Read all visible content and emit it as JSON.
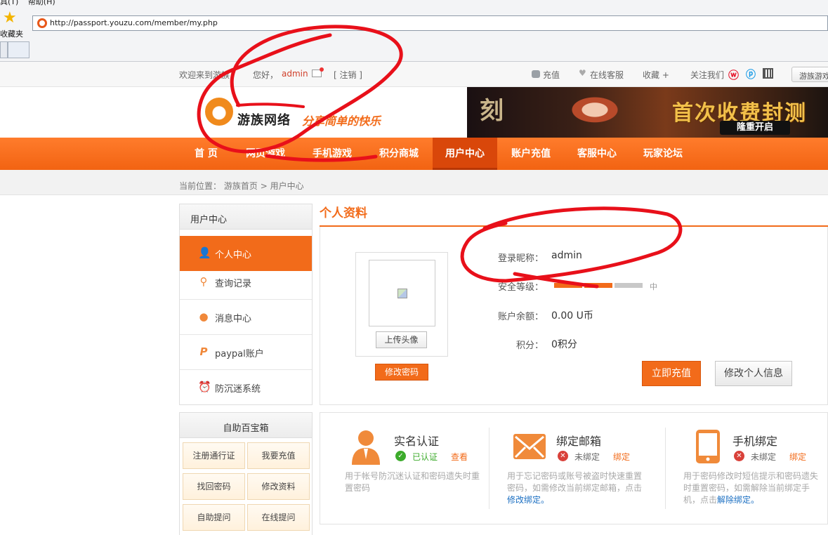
{
  "browser": {
    "menu_items": [
      "具(T)",
      "帮助(H)"
    ],
    "favorites_label": "收藏夹",
    "url": "http://passport.youzu.com/member/my.php"
  },
  "topbar": {
    "welcome": "欢迎来到游族！",
    "greeting": "您好，",
    "username": "admin",
    "logout": "[ 注销 ]",
    "recharge": "充值",
    "service": "在线客服",
    "favorite": "收藏 +",
    "follow": "关注我们",
    "site_switch": "游族游戏"
  },
  "header": {
    "logo_name": "游族网络",
    "slogan": "分享简单的快乐",
    "banner_deco": "刻",
    "banner_title": "首次收费封测",
    "banner_sub": "隆重开启"
  },
  "nav": {
    "items": [
      "首 页",
      "网页游戏",
      "手机游戏",
      "积分商城",
      "用户中心",
      "账户充值",
      "客服中心",
      "玩家论坛"
    ]
  },
  "breadcrumb": {
    "label": "当前位置：",
    "home": "游族首页",
    "sep": ">",
    "current": "用户中心"
  },
  "sidebar": {
    "title": "用户中心",
    "items": [
      {
        "label": "个人中心",
        "icon": "user-icon"
      },
      {
        "label": "查询记录",
        "icon": "search-icon"
      },
      {
        "label": "消息中心",
        "icon": "chat-icon"
      },
      {
        "label": "paypal账户",
        "icon": "paypal-icon"
      },
      {
        "label": "防沉迷系统",
        "icon": "alarm-clock-icon"
      }
    ]
  },
  "toolbox": {
    "title": "自助百宝箱",
    "buttons": [
      "注册通行证",
      "我要充值",
      "找回密码",
      "修改资料",
      "自助提问",
      "在线提问"
    ]
  },
  "profile": {
    "section_title": "个人资料",
    "upload_avatar": "上传头像",
    "change_password": "修改密码",
    "nickname_label": "登录昵称：",
    "nickname": "admin",
    "security_label": "安全等级：",
    "security_level_text": "中",
    "security_level_fraction": 0.5,
    "balance_label": "账户余额：",
    "balance": "0.00 U币",
    "points_label": "积分：",
    "points": "0积分",
    "recharge_btn": "立即充值",
    "edit_btn": "修改个人信息"
  },
  "security_cards": [
    {
      "title": "实名认证",
      "status": "已认证",
      "status_color": "#3cab2b",
      "link": "查看",
      "desc": "用于帐号防沉迷认证和密码遗失时重置密码",
      "desc_link": ""
    },
    {
      "title": "绑定邮箱",
      "status": "未绑定",
      "status_color": "#d9413a",
      "link": "绑定",
      "desc": "用于忘记密码或账号被盗时快速重置密码，如需修改当前绑定邮箱，点击",
      "desc_link": "修改绑定。"
    },
    {
      "title": "手机绑定",
      "status": "未绑定",
      "status_color": "#d9413a",
      "link": "绑定",
      "desc": "用于密码修改时短信提示和密码遗失时重置密码，如需解除当前绑定手机，点击",
      "desc_link": "解除绑定。"
    }
  ],
  "colors": {
    "accent": "#f26b1a",
    "nav_active": "#d9470a",
    "annotation_red": "#e8101a"
  }
}
